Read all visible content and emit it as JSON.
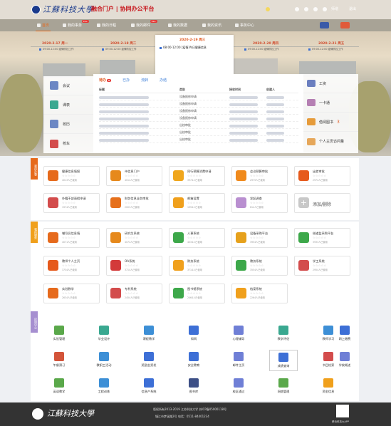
{
  "header": {
    "logo_text": "江蘇科技大學",
    "portal_title": "融合门户 | 协同办公平台",
    "user_name": "师增",
    "logout_label": "退出"
  },
  "nav": {
    "items": [
      {
        "label": "首页",
        "icon": "home-icon",
        "active": true
      },
      {
        "label": "我的事务",
        "icon": "tasks-icon",
        "badge": "99+"
      },
      {
        "label": "我的日程",
        "icon": "calendar-icon"
      },
      {
        "label": "我的邮件",
        "icon": "mail-icon",
        "badge": "99+"
      },
      {
        "label": "我的数据",
        "icon": "data-icon"
      },
      {
        "label": "我的资讯",
        "icon": "news-icon"
      },
      {
        "label": "事务中心",
        "icon": "center-icon"
      }
    ]
  },
  "calendar": {
    "days": [
      {
        "date": "2020-2-17 周一",
        "event": "09:00-12:00  疫情防控工作"
      },
      {
        "date": "2020-2-18 周二",
        "event": "09:00-12:00  疫情防控工作"
      },
      {
        "date": "2020-2-20 周四",
        "event": "09:00-12:00  疫情防控工作"
      },
      {
        "date": "2020-2-21 周五",
        "event": "09:00-12:00  疫情防控工作"
      }
    ],
    "today": {
      "date": "2020-2-19 周三",
      "event": "08:00-12:00  [疫情]今日健康信息"
    }
  },
  "left_panel": [
    {
      "label": "会议",
      "icon": "meeting-icon"
    },
    {
      "label": "课表",
      "icon": "schedule-icon"
    },
    {
      "label": "校历",
      "icon": "school-calendar-icon"
    },
    {
      "label": "校车",
      "icon": "bus-icon"
    }
  ],
  "todo": {
    "tabs": [
      {
        "label": "待办",
        "count": "8",
        "active": true
      },
      {
        "label": "已办"
      },
      {
        "label": "流转"
      },
      {
        "label": "办结"
      }
    ],
    "columns": [
      "标题",
      "类别",
      "接收时间",
      "创建人"
    ],
    "rows": [
      {
        "category": "设备报修申请"
      },
      {
        "category": "设备报修申请"
      },
      {
        "category": "设备报修申请"
      },
      {
        "category": "设备报修申请"
      },
      {
        "category": "出校审批"
      },
      {
        "category": "出校审批"
      },
      {
        "category": "出校审批"
      }
    ]
  },
  "right_panel": [
    {
      "label": "工资",
      "icon": "salary-icon",
      "color": "#6b7fbf"
    },
    {
      "label": "一卡通",
      "icon": "card-icon",
      "color": "#b57fb3"
    },
    {
      "label": "借阅图书",
      "icon": "book-icon",
      "color": "#e69b3a",
      "count": "3"
    },
    {
      "label": "个人主页访问量",
      "icon": "stats-icon",
      "color": "#e6a75a"
    }
  ],
  "my_services": {
    "tab_label": "我的办事",
    "items": [
      {
        "name": "健康信息填报",
        "count": "4013人已使用",
        "color": "#e66a1c"
      },
      {
        "name": "市信息门户",
        "count": "4014人已使用",
        "color": "#e6891c"
      },
      {
        "name": "同行预算消费申请",
        "count": "3974人已使用",
        "color": "#f0a61c"
      },
      {
        "name": "会议预算审批",
        "count": "2975人已使用",
        "color": "#f08a1c"
      },
      {
        "name": "出差审批",
        "count": "2974人已使用",
        "color": "#e65a1c"
      },
      {
        "name": "外籍干部请假申请",
        "count": "1974人已使用",
        "color": "#d34c4c"
      },
      {
        "name": "财务信息业务审批",
        "count": "2003人已使用",
        "color": "#e6701c"
      },
      {
        "name": "邮箱设置",
        "count": "1994人已使用",
        "color": "#f0a01c"
      },
      {
        "name": "发起调查",
        "count": "614人已使用",
        "color": "#b98fd0"
      }
    ],
    "add_label": "添加/删除"
  },
  "my_apps": {
    "tab_label": "我的服务",
    "items": [
      {
        "name": "辅导员信息填",
        "count": "4071人已使用",
        "color": "#e66a1c"
      },
      {
        "name": "研究生系统",
        "count": "4074人已使用",
        "color": "#e6891c"
      },
      {
        "name": "人事系统",
        "count": "4034人已使用",
        "color": "#3da84a"
      },
      {
        "name": "设备采购平台",
        "count": "3954人已使用",
        "color": "#e6a11c"
      },
      {
        "name": "借道监采购平台",
        "count": "3933人已使用",
        "color": "#3da84a"
      },
      {
        "name": "教师个人主页",
        "count": "3734人已使用",
        "color": "#e65a1c"
      },
      {
        "name": "OA系统",
        "count": "3714人已使用",
        "color": "#d33a3a"
      },
      {
        "name": "财务系统",
        "count": "3714人已使用",
        "color": "#f0a01c"
      },
      {
        "name": "教务系统",
        "count": "3554人已使用",
        "color": "#3da84a"
      },
      {
        "name": "学工系统",
        "count": "2954人已使用",
        "color": "#d34c4c"
      },
      {
        "name": "实验教学",
        "count": "2634人已使用",
        "color": "#e66a1c"
      },
      {
        "name": "专利系统",
        "count": "2454人已使用",
        "color": "#d34c4c"
      },
      {
        "name": "图书馆系统",
        "count": "2464人已使用",
        "color": "#3da84a"
      },
      {
        "name": "档案系统",
        "count": "2264人已使用",
        "color": "#f0a01c"
      }
    ]
  },
  "apps_grid": {
    "tab_label": "应用中心",
    "items": [
      {
        "name": "实验管理",
        "color": "#5aa84a"
      },
      {
        "name": "毕业设计",
        "color": "#3aa890"
      },
      {
        "name": "课程教学",
        "color": "#3d8fd6"
      },
      {
        "name": "知网",
        "color": "#3d6fd6"
      },
      {
        "name": "心理辅导",
        "color": "#6f7fd6"
      },
      {
        "name": "教学评估",
        "color": "#3aa890"
      },
      {
        "name": "教师学习",
        "color": "#3d8fd6"
      },
      {
        "name": "网上缴费",
        "color": "#3d6fd6"
      },
      {
        "name": "午餐预订",
        "color": "#d3543a"
      },
      {
        "name": "教职工活动",
        "color": "#3d8fd6"
      },
      {
        "name": "奖励金奖发",
        "color": "#3d6fd6"
      },
      {
        "name": "安全教育",
        "color": "#3d6fd6"
      },
      {
        "name": "邮件主页",
        "color": "#6f7fd6"
      },
      {
        "name": "成绩查询",
        "color": "#3d6fd6",
        "selected": true
      },
      {
        "name": "书目检索",
        "color": "#d34c4c"
      },
      {
        "name": "学校概述",
        "color": "#6f7fd6"
      },
      {
        "name": "英语教学",
        "color": "#5aa84a"
      },
      {
        "name": "工程训练",
        "color": "#3d8fd6"
      },
      {
        "name": "信息产系统",
        "color": "#3d6fd6"
      },
      {
        "name": "图书库",
        "color": "#3d4f86"
      },
      {
        "name": "校区通过",
        "color": "#6f7fd6"
      },
      {
        "name": "网络管理",
        "color": "#5aa84a"
      },
      {
        "name": "资金信息",
        "color": "#f0a01c"
      }
    ]
  },
  "footer": {
    "logo_text": "江蘇科技大學",
    "copyright": "版权所有2013-2019  江苏科技大学  苏ICP备05000118号",
    "address": "镇江市梦溪路2号  电话：0511-84401234",
    "qr_label": "移动科技大APP"
  }
}
